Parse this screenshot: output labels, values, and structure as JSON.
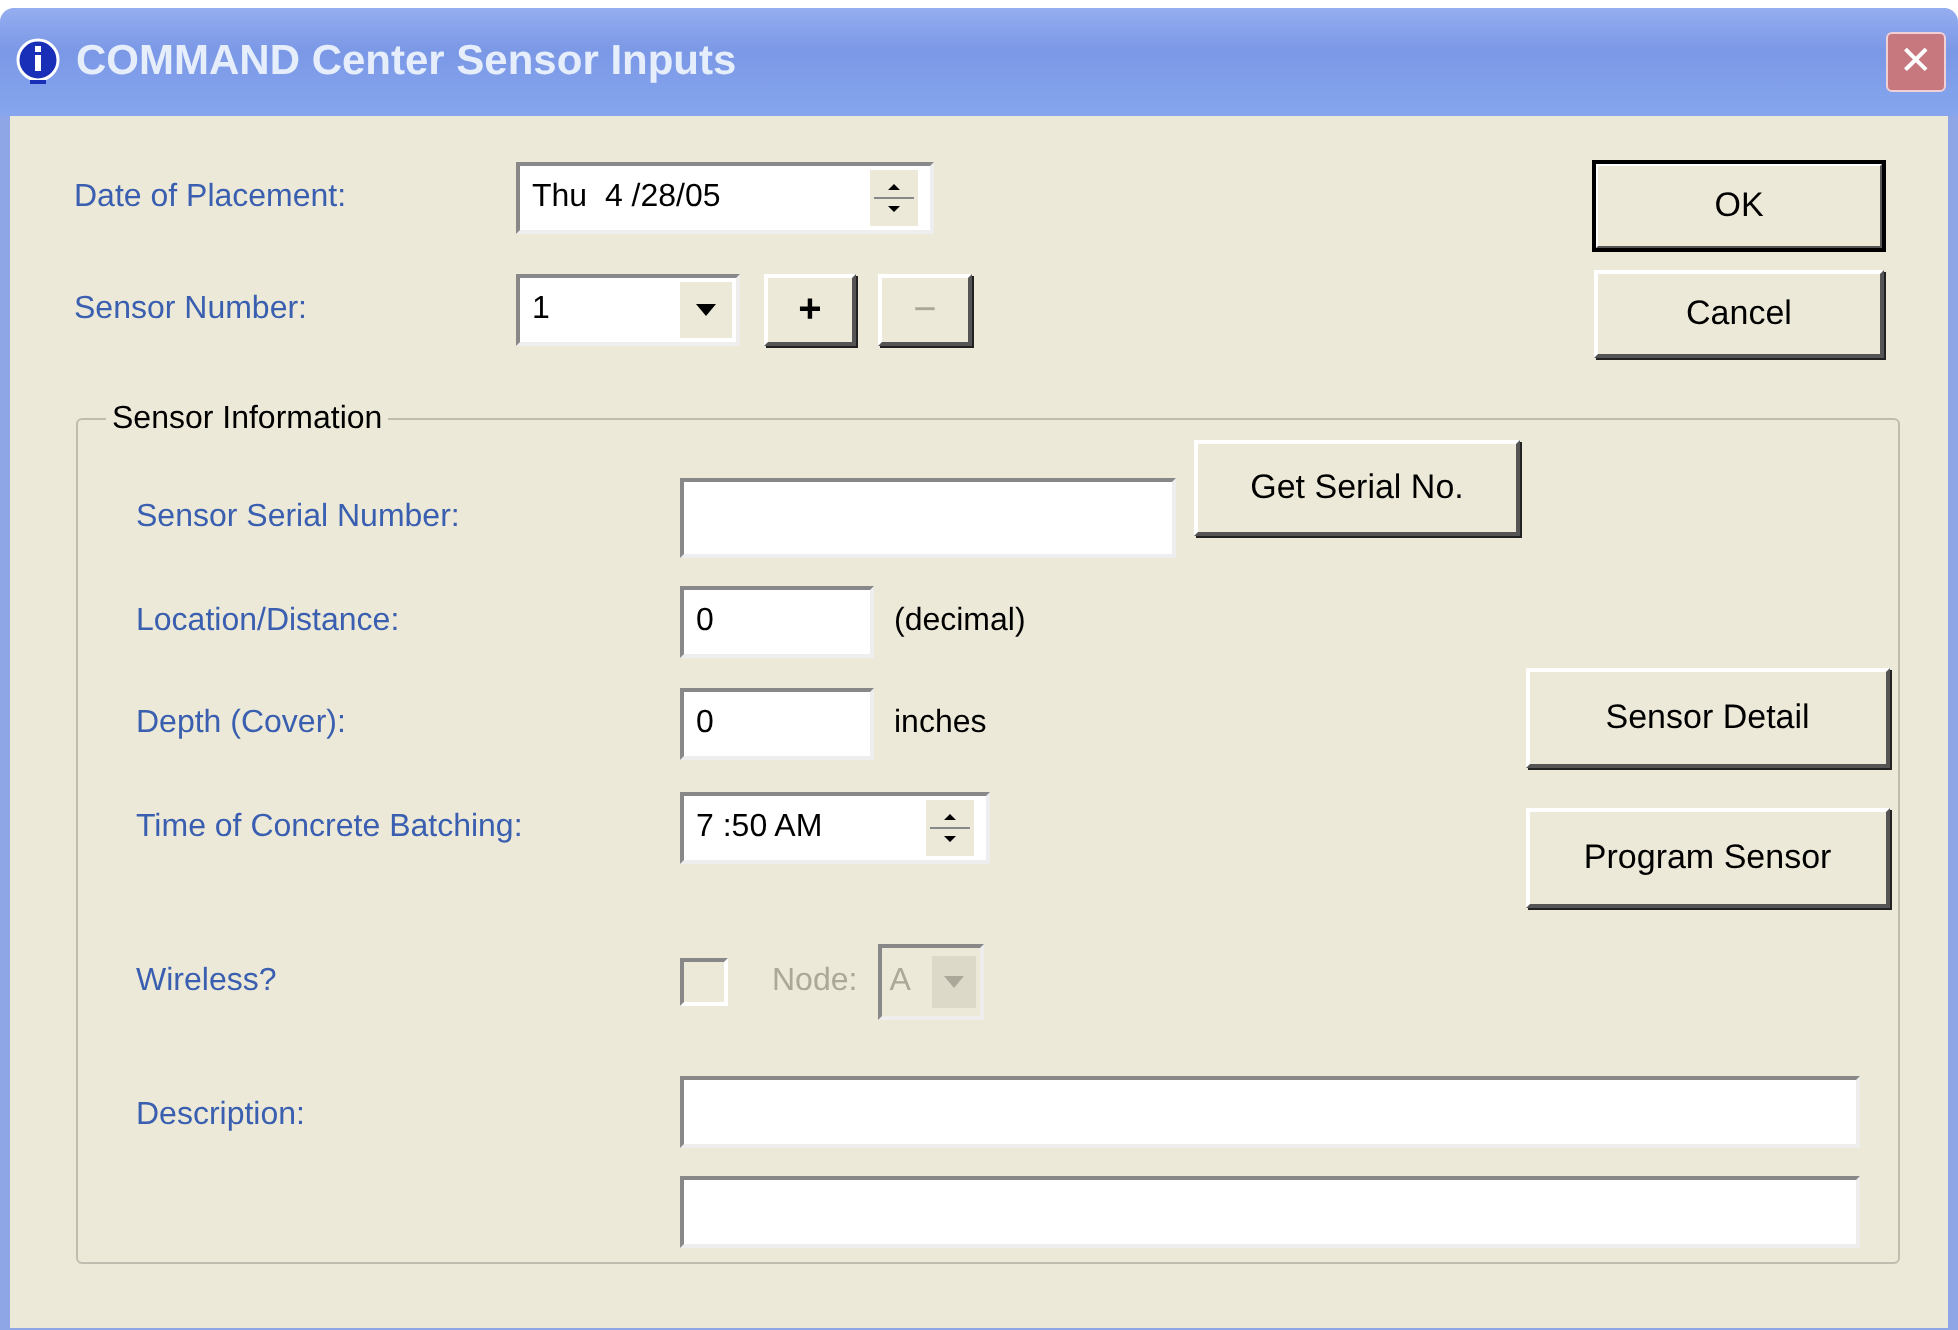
{
  "window": {
    "title": "COMMAND Center Sensor Inputs",
    "close": "✕"
  },
  "date_of_placement": {
    "label": "Date of Placement:",
    "value": "Thu  4 /28/05"
  },
  "sensor_number": {
    "label": "Sensor Number:",
    "value": "1",
    "add_button": "+",
    "remove_button": "−",
    "remove_disabled": true
  },
  "buttons": [
    {
      "label": "OK",
      "default": true
    },
    {
      "label": "Cancel",
      "default": false
    }
  ],
  "sensor_information": {
    "title": "Sensor Information",
    "serial_number": {
      "label": "Sensor Serial Number:",
      "button": "Get Serial No."
    },
    "location_distance": {
      "label": "Location/Distance:",
      "value": "0",
      "unit": "(decimal)"
    },
    "depth_cover": {
      "label": "Depth (Cover):",
      "value": "0",
      "unit": "inches"
    },
    "time_of_batching": {
      "label": "Time of Concrete Batching:",
      "value": "7 :50 AM"
    },
    "wireless": {
      "label": "Wireless?",
      "checked": false,
      "disabled": true,
      "node_label": "Node:",
      "node_value": "A"
    },
    "description": {
      "label": "Description:"
    },
    "side_buttons": [
      "Sensor Detail",
      "Program Sensor"
    ]
  }
}
